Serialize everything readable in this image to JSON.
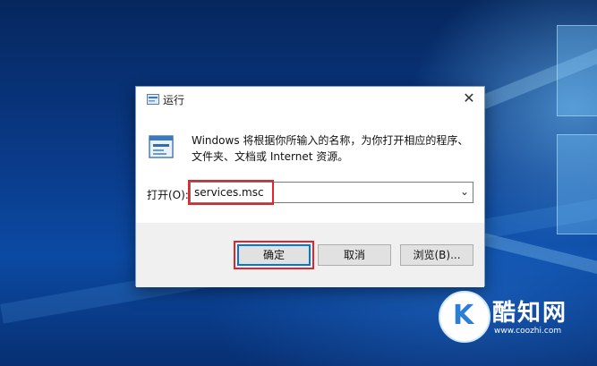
{
  "dialog": {
    "title": "运行",
    "close_glyph": "✕",
    "description": "Windows 将根据你所输入的名称，为你打开相应的程序、文件夹、文档或 Internet 资源。",
    "open_label": "打开(O):",
    "open_value": "services.msc",
    "buttons": {
      "ok": "确定",
      "cancel": "取消",
      "browse": "浏览(B)..."
    },
    "icons": [
      "run-icon",
      "chevron-down-icon",
      "close-icon"
    ]
  },
  "watermark": {
    "name": "酷知网",
    "url": "www.coozhi.com"
  },
  "colors": {
    "highlight": "#e2252c",
    "accent": "#0078d7",
    "desktop": "#0a3b8a"
  }
}
